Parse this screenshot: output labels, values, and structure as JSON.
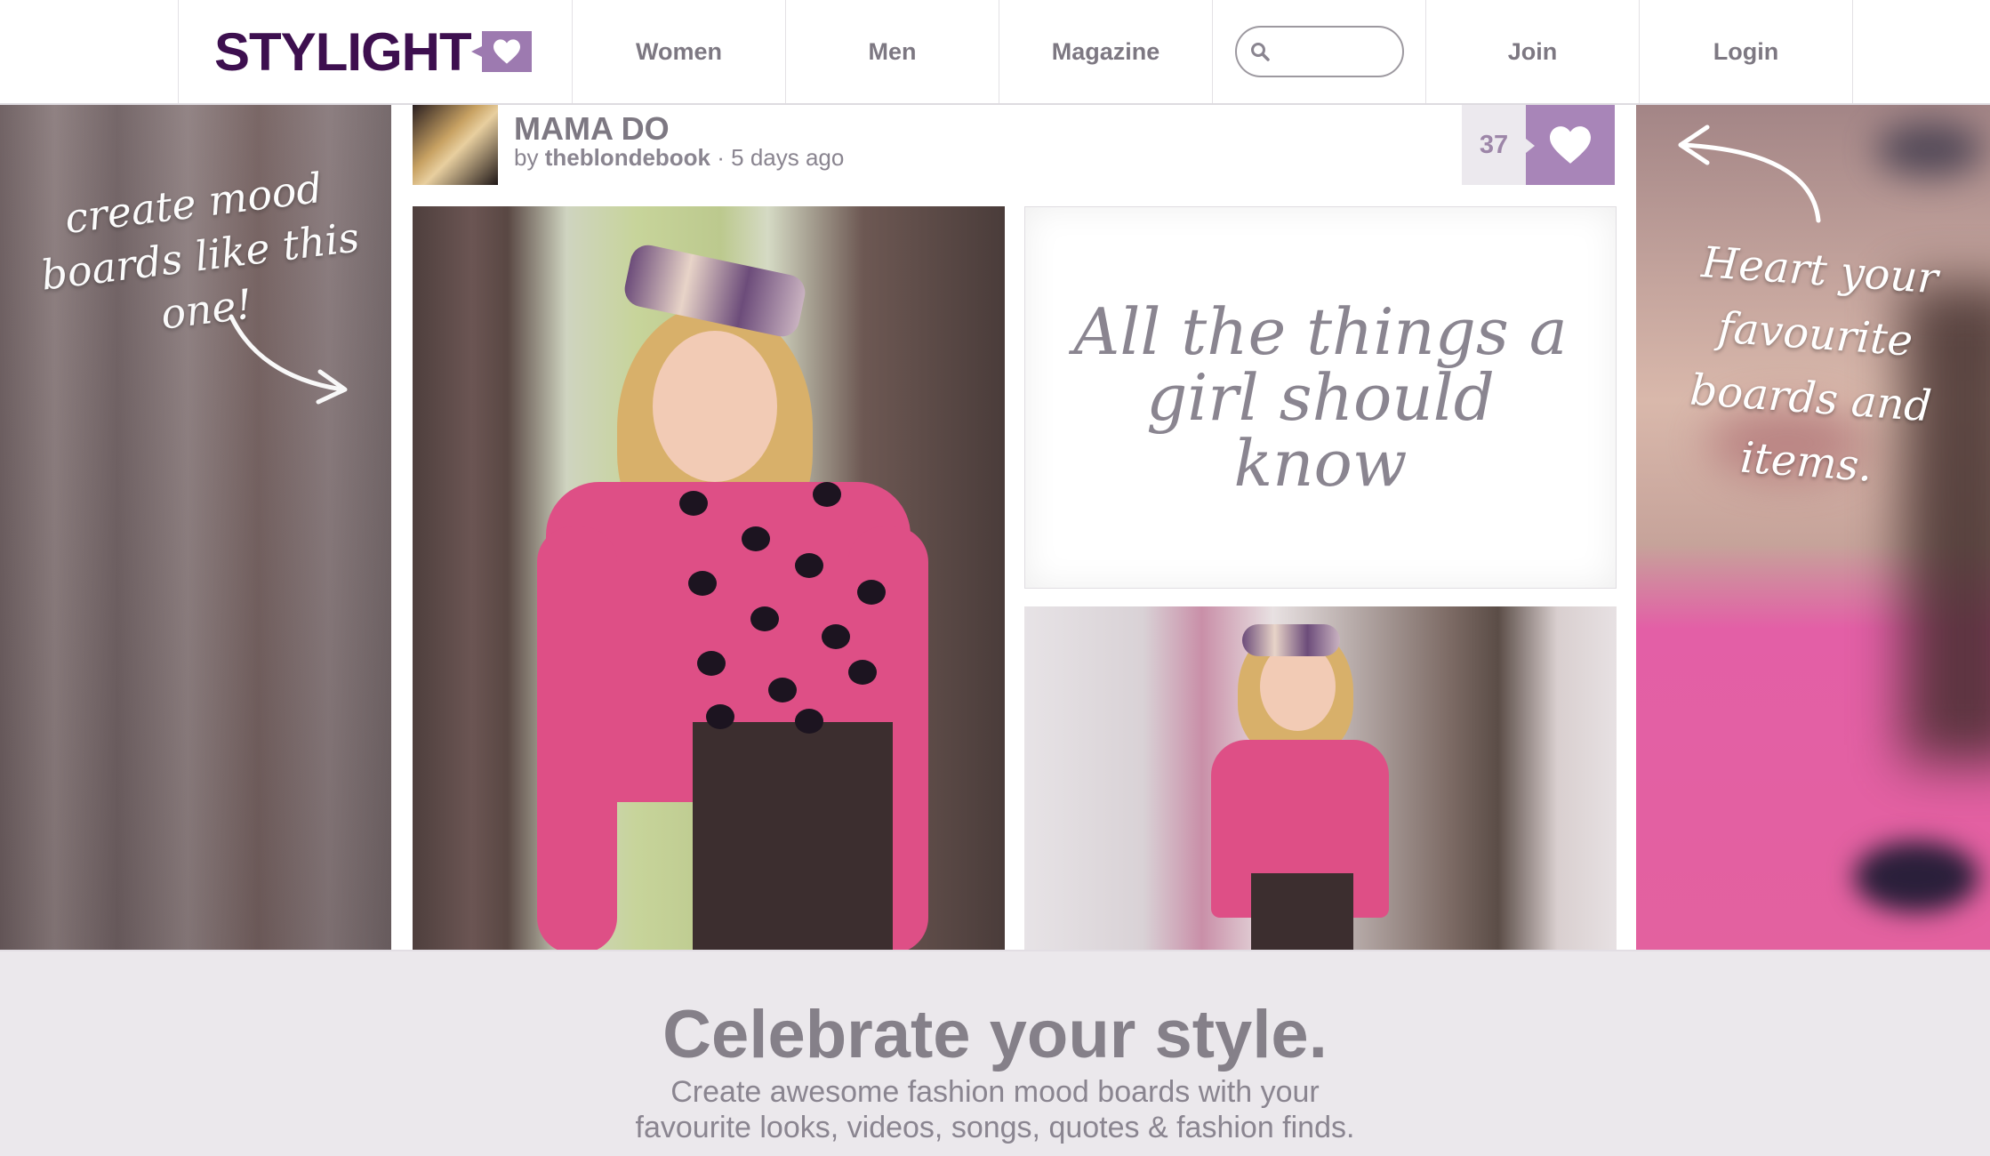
{
  "header": {
    "logo": "STYLIGHT",
    "nav": [
      "Women",
      "Men",
      "Magazine"
    ],
    "search": {
      "value": "",
      "placeholder": ""
    },
    "join_label": "Join",
    "login_label": "Login"
  },
  "left_note": "create mood boards like this one!",
  "right_note": "Heart your favourite boards and items.",
  "board": {
    "title": "MAMA DO",
    "by_label": "by",
    "author": "theblondebook",
    "time": "· 5 days ago",
    "likes": "37",
    "quote": "All the things a girl should know"
  },
  "banner": {
    "headline": "Celebrate your style.",
    "subline_1": "Create awesome fashion mood boards with your",
    "subline_2": "favourite looks, videos, songs, quotes & fashion finds."
  },
  "colors": {
    "brand_purple": "#3d0f4f",
    "heart_purple": "#a885b8",
    "text_gray": "#7d7882",
    "banner_bg": "#ebe8ec"
  },
  "icons": [
    "heart-icon",
    "search-icon",
    "arrow-icon"
  ]
}
